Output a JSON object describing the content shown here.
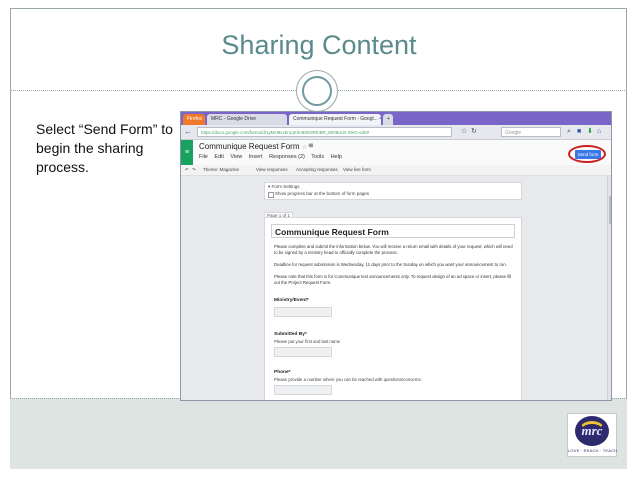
{
  "slide": {
    "title": "Sharing Content",
    "instruction": "Select “Send Form” to begin the sharing process."
  },
  "browser": {
    "tabs": [
      {
        "label": "Firefox",
        "style": "orange"
      },
      {
        "label": "MRC - Google Drive"
      },
      {
        "label": "Communique Request Form - Googl... ×"
      },
      {
        "label": "+"
      }
    ],
    "url": "https://docs.google.com/forms/d/1yMH9vxbr1qKhn8SE9RfcBR_MOBur2I-39rG-edit#",
    "search_placeholder": "Google",
    "nav_back": "←",
    "nav_forward": "→"
  },
  "form_app": {
    "doc_title": "Communique Request Form",
    "menu": [
      "File",
      "Edit",
      "View",
      "Insert",
      "Responses (2)",
      "Tools",
      "Help"
    ],
    "send_form_label": "Send form",
    "subbar": {
      "theme": "Theme: Magazine",
      "view_responses": "View responses",
      "accepting": "Accepting responses",
      "view_live": "View live form"
    },
    "settings": {
      "header": "▾ Form Settings",
      "option": "Show progress bar at the bottom of form pages"
    },
    "page_tag": "Page 1 of 1",
    "form_title": "Communique Request Form",
    "desc1": "Please complete and submit the information below. You will receive a return email with details of your request, which will need to be signed by a ministry head to officially complete the process.",
    "desc2": "Deadline for request submission is Wednesday, 11 days prior to the Sunday on which you want your announcement to run.",
    "desc3": "Please note that this form is for Communique text announcements only. To request design of an ad space or insert, please fill out the Project Request Form.",
    "questions": [
      {
        "label": "Ministry/Event*",
        "help": ""
      },
      {
        "label": "Submitted By*",
        "help": "Please put your first and last name"
      },
      {
        "label": "Phone*",
        "help": "Please provide a number where you can be reached with questions/concerns."
      }
    ]
  },
  "logo": {
    "text": "mrc",
    "tagline": "LOVE · REACH · TEACH"
  },
  "colors": {
    "title": "#5a8a8c",
    "send_button": "#3b78e7",
    "highlight_circle": "#cc1f1f",
    "forms_green": "#19a15f",
    "tabbar": "#7a65c8"
  }
}
